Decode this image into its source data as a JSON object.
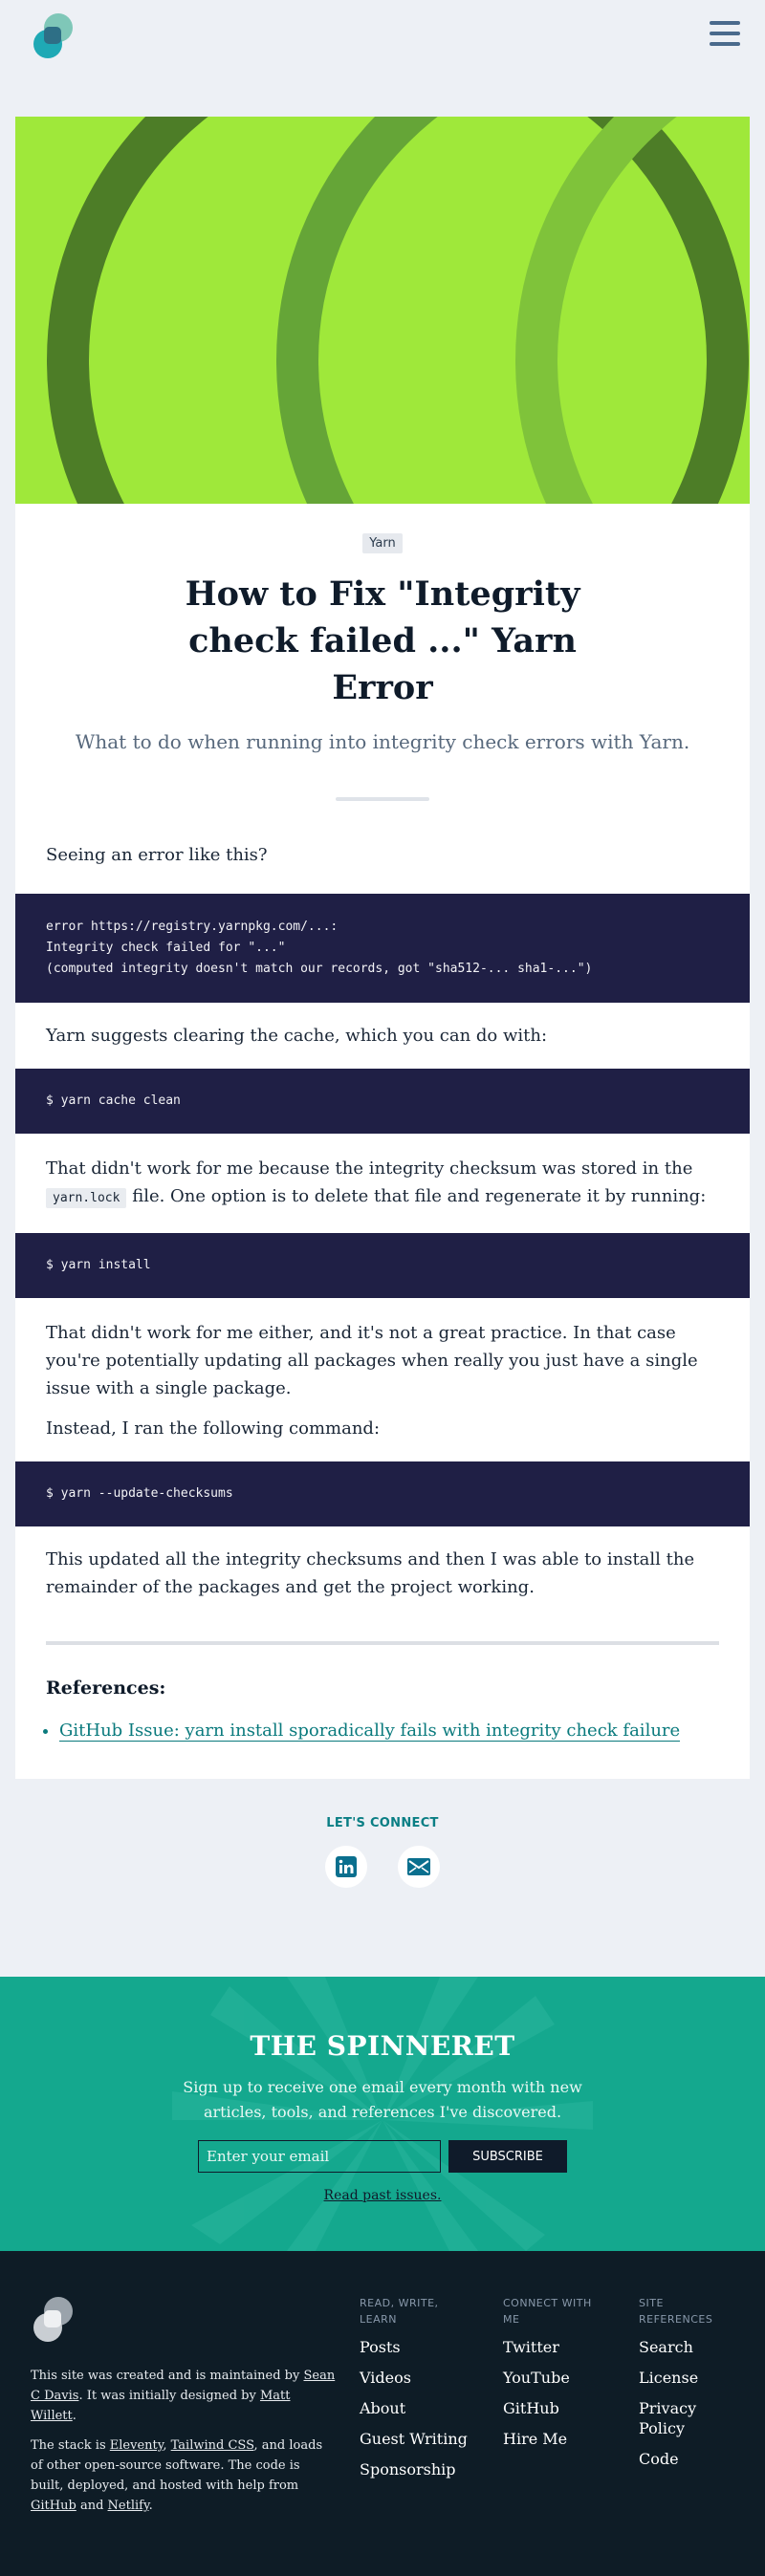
{
  "article": {
    "tag": "Yarn",
    "title": "How to Fix \"Integrity check failed ...\" Yarn Error",
    "subtitle": "What to do when running into integrity check errors with Yarn.",
    "p1": "Seeing an error like this?",
    "code1": {
      "line1": "error https://registry.yarnpkg.com/...:",
      "line2": "Integrity check failed for \"...\"",
      "line3": "(computed integrity doesn't match our records, got \"sha512-... sha1-...\")"
    },
    "p2": "Yarn suggests clearing the cache, which you can do with:",
    "code2": "$ yarn cache clean",
    "p3_part1": "That didn't work for me because the integrity checksum was stored in the",
    "p3_code": "yarn.lock",
    "p3_part2": "file. One option is to delete that file and regenerate it by running:",
    "code3": "$ yarn install",
    "p4": "That didn't work for me either, and it's not a great practice. In that case you're potentially updating all packages when really you just have a single issue with a single package.",
    "p5": "Instead, I ran the following command:",
    "code4": "$ yarn --update-checksums",
    "p6": "This updated all the integrity checksums and then I was able to install the remainder of the packages and get the project working.",
    "references_title": "References:",
    "references": [
      "GitHub Issue: yarn install sporadically fails with integrity check failure"
    ]
  },
  "connect": {
    "title": "LET'S CONNECT",
    "icons": [
      "linkedin-icon",
      "email-icon"
    ]
  },
  "newsletter": {
    "title": "THE SPINNERET",
    "text": "Sign up to receive one email every month with new articles, tools, and references I've discovered.",
    "input_placeholder": "Enter your email",
    "button": "SUBSCRIBE",
    "past_link": "Read past issues."
  },
  "footer": {
    "about1_a": "This site was created and is maintained by ",
    "about1_link1": "Sean C Davis",
    "about1_b": ". It was initially designed by ",
    "about1_link2": "Matt Willett",
    "about1_c": ".",
    "about2_a": "The stack is ",
    "about2_link1": "Eleventy",
    "about2_b": ", ",
    "about2_link2": "Tailwind CSS",
    "about2_c": ", and loads of other open-source software. The code is built, deployed, and hosted with help from ",
    "about2_link3": "GitHub",
    "about2_d": " and ",
    "about2_link4": "Netlify",
    "about2_e": ".",
    "col1": {
      "title": "READ, WRITE, LEARN",
      "items": [
        "Posts",
        "Videos",
        "About",
        "Guest Writing",
        "Sponsorship"
      ]
    },
    "col2": {
      "title": "CONNECT WITH ME",
      "items": [
        "Twitter",
        "YouTube",
        "GitHub",
        "Hire Me"
      ]
    },
    "col3": {
      "title": "SITE REFERENCES",
      "items": [
        "Search",
        "License",
        "Privacy Policy",
        "Code"
      ]
    }
  },
  "colors": {
    "hero_bg": "#9fe83a",
    "code_bg": "#1f1f45",
    "newsletter_bg": "#14a88e",
    "footer_bg": "#0e1c26",
    "accent": "#0a7e84"
  }
}
